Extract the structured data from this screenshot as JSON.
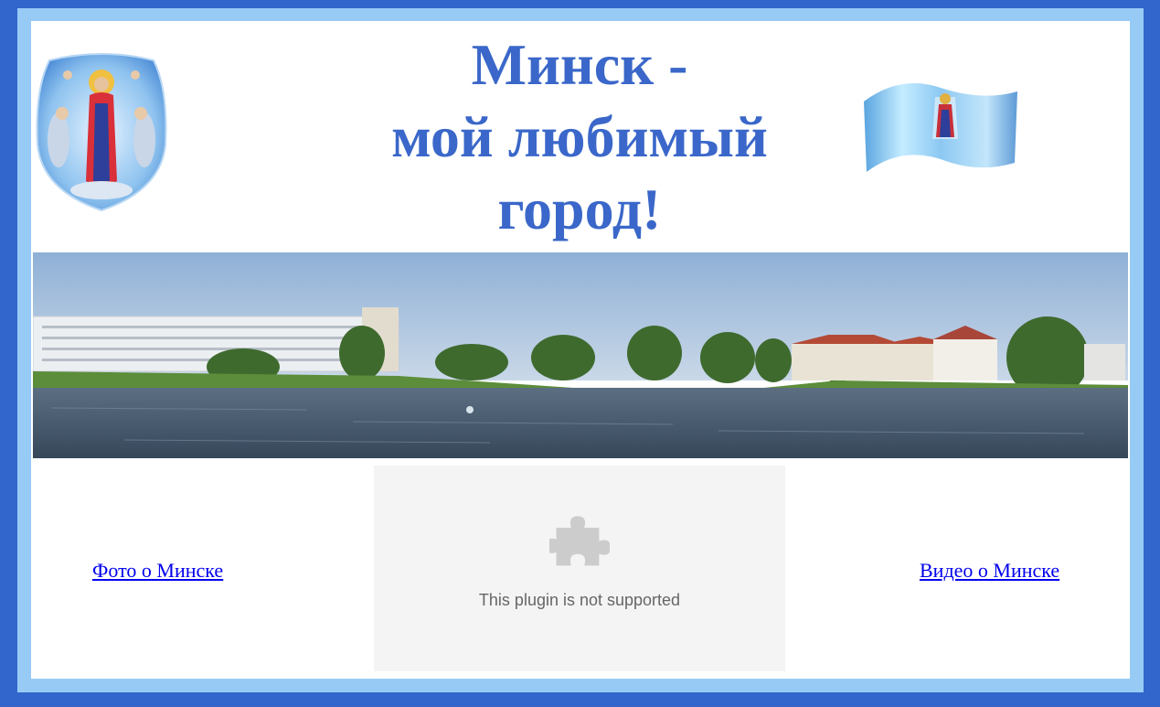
{
  "header": {
    "title_line1": "Минск -",
    "title_line2": "мой любимый",
    "title_line3": "город!"
  },
  "images": {
    "left_emblem": "coat-of-arms-icon",
    "right_flag": "city-flag-icon",
    "panorama": "minsk-river-panorama"
  },
  "links": {
    "photo": "Фото о Минске",
    "video": "Видео о Минске"
  },
  "plugin": {
    "icon": "puzzle-icon",
    "message": "This plugin is not supported"
  },
  "colors": {
    "outer_border": "#3266cc",
    "inner_border": "#97cbf6",
    "title": "#3a67c9",
    "link": "#0000ee",
    "plugin_bg": "#f4f4f4"
  }
}
